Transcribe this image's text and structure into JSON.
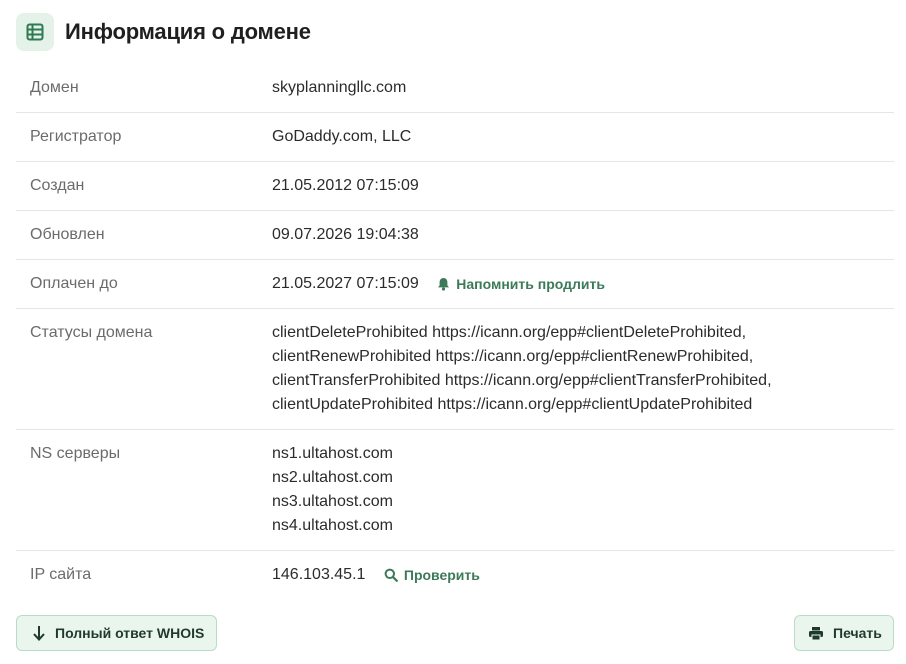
{
  "header": {
    "title": "Информация о домене",
    "icon": "table-icon"
  },
  "rows": [
    {
      "label": "Домен",
      "value": "skyplanningllc.com"
    },
    {
      "label": "Регистратор",
      "value": "GoDaddy.com, LLC"
    },
    {
      "label": "Создан",
      "value": "21.05.2012 07:15:09"
    },
    {
      "label": "Обновлен",
      "value": "09.07.2026 19:04:38"
    },
    {
      "label": "Оплачен до",
      "value": "21.05.2027 07:15:09",
      "action": "Напомнить продлить",
      "action_icon": "bell-icon"
    },
    {
      "label": "Статусы домена",
      "lines": [
        "clientDeleteProhibited https://icann.org/epp#clientDeleteProhibited,",
        "clientRenewProhibited https://icann.org/epp#clientRenewProhibited,",
        "clientTransferProhibited https://icann.org/epp#clientTransferProhibited,",
        "clientUpdateProhibited https://icann.org/epp#clientUpdateProhibited"
      ]
    },
    {
      "label": "NS серверы",
      "lines": [
        "ns1.ultahost.com",
        "ns2.ultahost.com",
        "ns3.ultahost.com",
        "ns4.ultahost.com"
      ]
    },
    {
      "label": "IP сайта",
      "value": "146.103.45.1",
      "action": "Проверить",
      "action_icon": "search-icon"
    }
  ],
  "buttons": {
    "whois": {
      "label": "Полный ответ WHOIS",
      "icon": "arrow-down-icon"
    },
    "print": {
      "label": "Печать",
      "icon": "printer-icon"
    }
  },
  "colors": {
    "accent": "#3c7a5a",
    "button_bg": "#eaf5ee",
    "button_border": "#b9dcc8",
    "icon_bg": "#e4f2ea"
  }
}
